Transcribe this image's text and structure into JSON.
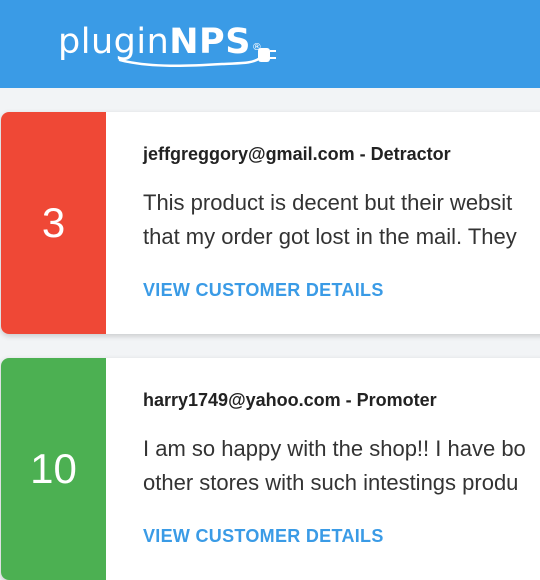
{
  "header": {
    "logo_light": "plugin",
    "logo_bold": "NPS",
    "logo_mark": "®"
  },
  "responses": [
    {
      "score": "3",
      "email": "jeffgreggory@gmail.com",
      "separator": " - ",
      "category": "Detractor",
      "comment_line1": "This product is decent but their websit",
      "comment_line2": "that my order got lost in the mail. They",
      "link_label": "VIEW CUSTOMER DETAILS",
      "color": "#ef4836"
    },
    {
      "score": "10",
      "email": "harry1749@yahoo.com",
      "separator": " - ",
      "category": "Promoter",
      "comment_line1": "I am so happy with the shop!! I have bo",
      "comment_line2": "other stores with such intestings produ",
      "link_label": "VIEW CUSTOMER DETAILS",
      "color": "#4cb052"
    }
  ],
  "colors": {
    "header": "#3a9be6",
    "link": "#3a9be6"
  }
}
